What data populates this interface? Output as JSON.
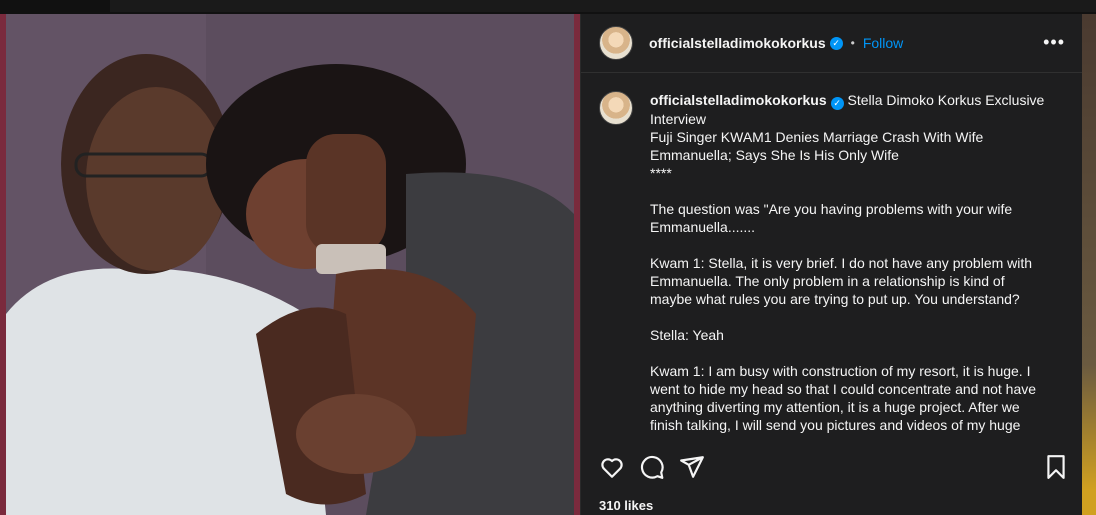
{
  "post": {
    "username": "officialstelladimokokorkus",
    "follow_label": "Follow",
    "separator": "•",
    "more_label": "•••",
    "caption_intro": "Stella Dimoko Korkus Exclusive Interview",
    "caption_body": "\nFuji Singer KWAM1 Denies Marriage Crash With Wife Emmanuella; Says She Is His Only Wife\n****\n\nThe question was \"Are you having problems with your wife Emmanuella.......\n\nKwam 1: Stella, it is very brief. I do not have any problem with Emmanuella. The only problem in a relationship is kind of maybe what rules you are trying to put up. You understand?\n\nStella: Yeah\n\nKwam 1: I am busy with construction of my resort, it is huge. I went to hide my head so that I could concentrate and not have anything diverting my attention, it is a huge project. After we finish talking, I will send you pictures and videos of my huge",
    "likes": "310 likes"
  },
  "icons": {
    "like": "heart-icon",
    "comment": "comment-icon",
    "share": "share-icon",
    "save": "bookmark-icon",
    "verified": "verified-badge-icon"
  },
  "colors": {
    "accent": "#0095f6",
    "panel_bg": "#1e1e1f",
    "media_border": "#7a2a3d"
  }
}
